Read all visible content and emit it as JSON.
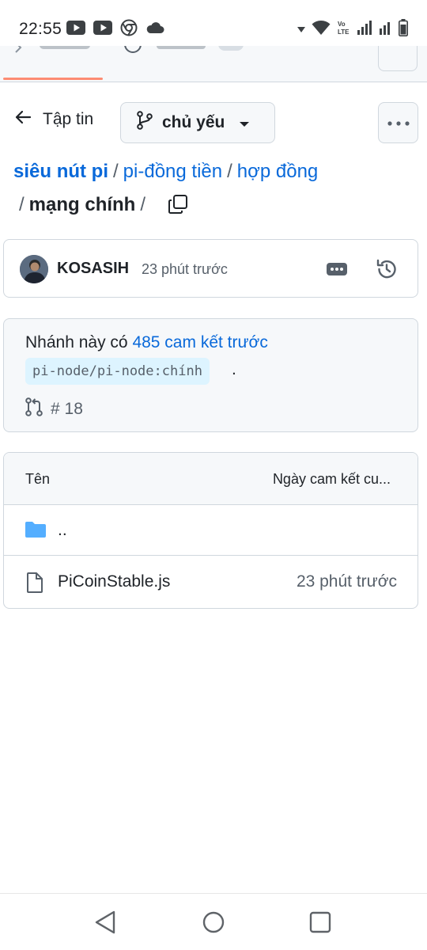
{
  "status_bar": {
    "time": "22:55",
    "left_icons": [
      "youtube-icon",
      "youtube-icon",
      "chrome-icon",
      "cloud-icon"
    ],
    "right_icons": [
      "vibrate-icon",
      "wifi-icon",
      "volte-icon",
      "signal-icon",
      "signal-icon",
      "battery-icon"
    ],
    "volte_text": "Vo LTE"
  },
  "header": {
    "back_label": "Tập tin",
    "branch_label": "chủ yếu"
  },
  "breadcrumb": {
    "root": "siêu nút pi",
    "items": [
      "pi-đồng tiền",
      "hợp đồng"
    ],
    "current": "mạng chính",
    "separator": "/"
  },
  "commit": {
    "author": "KOSASIH",
    "time": "23 phút trước"
  },
  "branch_info": {
    "prefix": "Nhánh này có",
    "link": "485 cam kết trước",
    "ref": "pi-node/pi-node:chính",
    "suffix": ".",
    "pr": "# 18"
  },
  "files_table": {
    "col_name": "Tên",
    "col_date": "Ngày cam kết cu...",
    "rows": [
      {
        "icon": "folder-icon",
        "name": "..",
        "date": ""
      },
      {
        "icon": "file-icon",
        "name": "PiCoinStable.js",
        "date": "23 phút trước"
      }
    ]
  },
  "colors": {
    "link": "#0969da",
    "accent_underline": "#fd8c73",
    "folder": "#54aeff",
    "code_bg": "#ddf4ff"
  }
}
